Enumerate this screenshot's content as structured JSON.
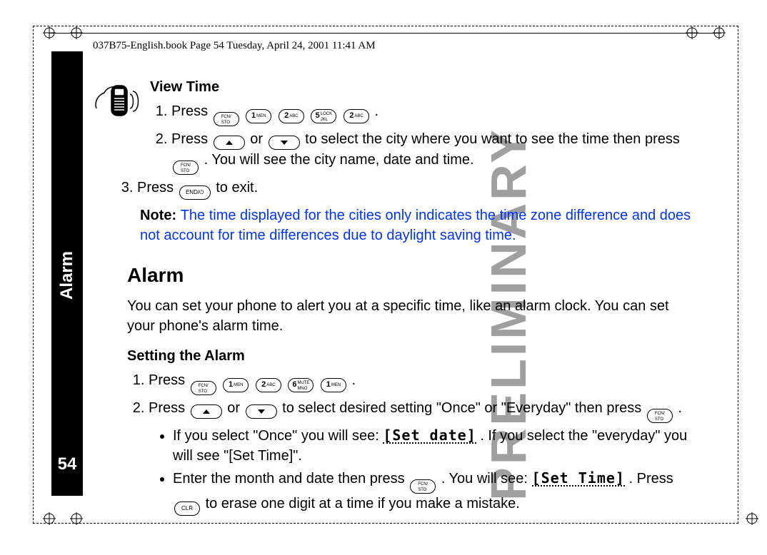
{
  "running_head": "037B75-English.book  Page 54  Tuesday, April 24, 2001  11:41 AM",
  "spine": {
    "section": "Alarm",
    "page_no": "54"
  },
  "watermark": "PRELIMINARY",
  "view_time": {
    "heading": "View Time",
    "step1_prefix": "Press ",
    "step1_suffix": ".",
    "step2_a": "Press ",
    "step2_b": " or ",
    "step2_c": "to select the city where you want to see the time then press ",
    "step2_d": ". You will see the city name, date and time.",
    "step3_a": "Press ",
    "step3_b": " to exit.",
    "note_label": "Note: ",
    "note_body": "The time displayed for the cities only indicates the time zone difference and does not account for time differences due to daylight saving time."
  },
  "alarm": {
    "heading": "Alarm",
    "intro": "You can set your phone to alert you at a specific time, like an alarm clock. You can set your phone's alarm time.",
    "setting_heading": "Setting the Alarm",
    "step1_prefix": "Press ",
    "step1_suffix": ".",
    "step2_a": "Press ",
    "step2_b": " or ",
    "step2_c": "to select desired setting \"Once\" or \"Everyday\" then press ",
    "step2_d": ".",
    "b1_a": "If you select \"Once\" you will see: ",
    "b1_lcd1": "[Set date]",
    "b1_b": ". If you select the \"everyday\" you will see \"[Set Time]\".",
    "b2_a": "Enter the month and date then press ",
    "b2_b": ". You will see:",
    "b2_lcd": "[Set Time]",
    "b2_c": ". Press ",
    "b2_d": " to erase one digit at a time if you make a mistake."
  },
  "keys": {
    "fcn": {
      "top": "FCN/",
      "bottom": "STO"
    },
    "one": {
      "digit": "1",
      "sub": "MEN"
    },
    "two": {
      "digit": "2",
      "sub": "ABC"
    },
    "five": {
      "digit": "5",
      "sub": "LOCK",
      "sub2": "JKL"
    },
    "six": {
      "digit": "6",
      "sub": "MUTE",
      "sub2": "MNO"
    },
    "end": "END/⏻",
    "clr": "CLR"
  }
}
